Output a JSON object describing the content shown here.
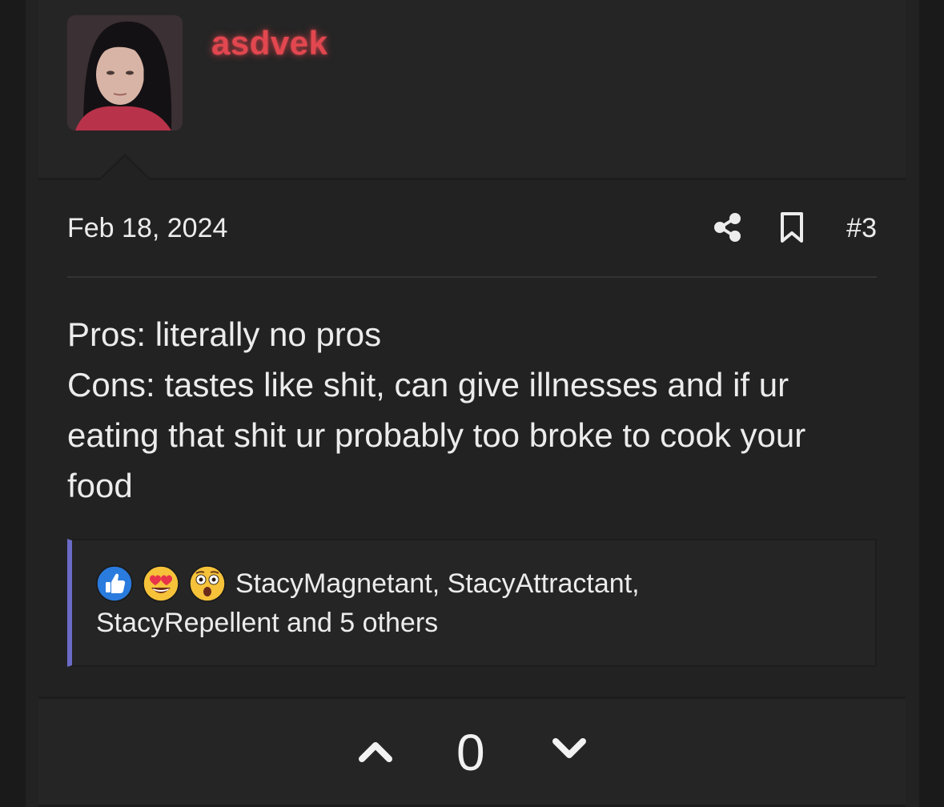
{
  "post": {
    "username": "asdvek",
    "date": "Feb 18, 2024",
    "number": "#3",
    "body_lines": [
      "Pros: literally no pros",
      "Cons: tastes like shit, can give illnesses and if ur",
      "eating that shit ur probably too broke to cook your",
      "food"
    ]
  },
  "actions": {
    "share_icon": "share-icon",
    "bookmark_icon": "bookmark-icon"
  },
  "reactions": {
    "emojis": [
      "like-icon",
      "heart-eyes-icon",
      "astonished-icon"
    ],
    "line1": "StacyMagnetant, StacyAttractant,",
    "line2": "StacyRepellent and 5 others"
  },
  "votes": {
    "count": "0"
  },
  "colors": {
    "username": "#e2474f",
    "reaction_accent": "#6b6bc7",
    "background": "#222222"
  }
}
